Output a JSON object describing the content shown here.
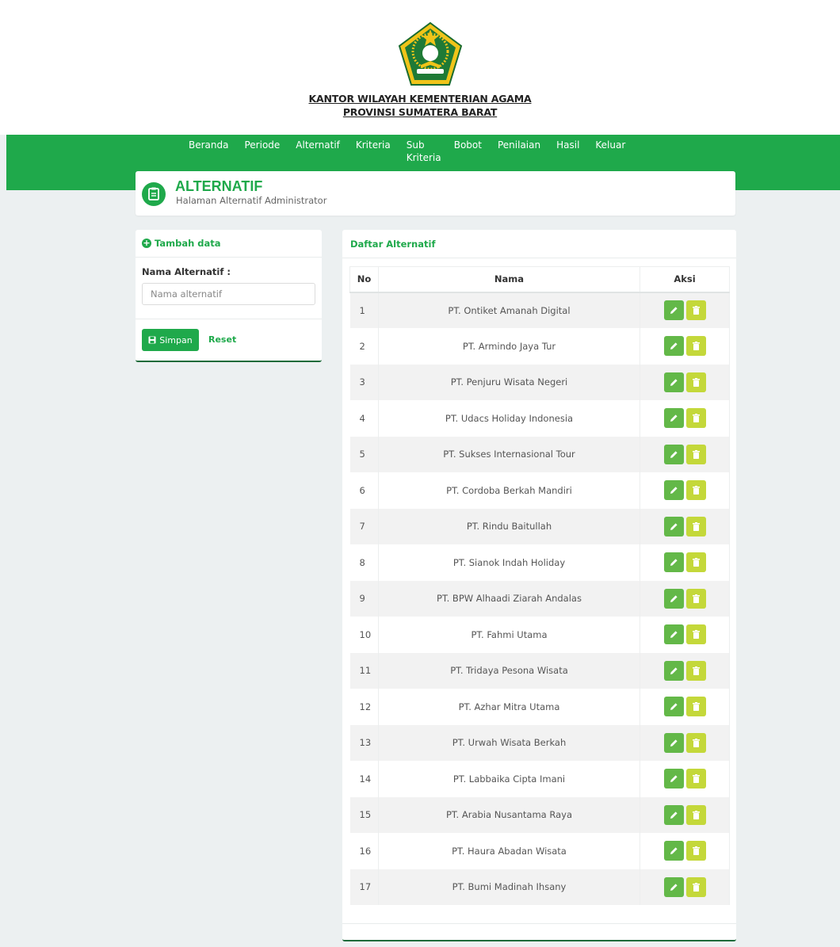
{
  "institution": {
    "line1": "KANTOR WILAYAH KEMENTERIAN AGAMA",
    "line2": "PROVINSI SUMATERA BARAT"
  },
  "nav": [
    "Beranda",
    "Periode",
    "Alternatif",
    "Kriteria",
    "Sub Kriteria",
    "Bobot",
    "Penilaian",
    "Hasil",
    "Keluar"
  ],
  "header": {
    "title": "ALTERNATIF",
    "subtitle": "Halaman Alternatif Administrator"
  },
  "form": {
    "heading": "Tambah data",
    "label": "Nama Alternatif :",
    "placeholder": "Nama alternatif",
    "save_label": "Simpan",
    "reset_label": "Reset"
  },
  "list": {
    "heading": "Daftar Alternatif",
    "columns": [
      "No",
      "Nama",
      "Aksi"
    ],
    "rows": [
      {
        "no": "1",
        "nama": "PT. Ontiket Amanah Digital"
      },
      {
        "no": "2",
        "nama": "PT. Armindo Jaya Tur"
      },
      {
        "no": "3",
        "nama": "PT. Penjuru Wisata Negeri"
      },
      {
        "no": "4",
        "nama": "PT. Udacs Holiday Indonesia"
      },
      {
        "no": "5",
        "nama": "PT. Sukses Internasional Tour"
      },
      {
        "no": "6",
        "nama": "PT. Cordoba Berkah Mandiri"
      },
      {
        "no": "7",
        "nama": "PT. Rindu Baitullah"
      },
      {
        "no": "8",
        "nama": "PT. Sianok Indah Holiday"
      },
      {
        "no": "9",
        "nama": "PT. BPW Alhaadi Ziarah Andalas"
      },
      {
        "no": "10",
        "nama": "PT. Fahmi Utama"
      },
      {
        "no": "11",
        "nama": "PT. Tridaya Pesona Wisata"
      },
      {
        "no": "12",
        "nama": "PT. Azhar Mitra Utama"
      },
      {
        "no": "13",
        "nama": "PT. Urwah Wisata Berkah"
      },
      {
        "no": "14",
        "nama": "PT. Labbaika Cipta Imani"
      },
      {
        "no": "15",
        "nama": "PT. Arabia Nusantama Raya"
      },
      {
        "no": "16",
        "nama": "PT. Haura Abadan Wisata"
      },
      {
        "no": "17",
        "nama": "PT. Bumi Madinah Ihsany"
      }
    ]
  },
  "colors": {
    "brand_green": "#1fa94b",
    "edit_button": "#63b848",
    "delete_button": "#c4d83a"
  },
  "icons": [
    "ministry-logo",
    "clipboard-icon",
    "plus-circle-icon",
    "save-icon",
    "pencil-icon",
    "trash-icon"
  ]
}
